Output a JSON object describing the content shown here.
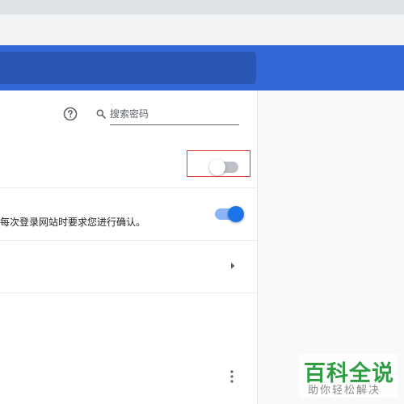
{
  "search": {
    "placeholder": "搜索密码",
    "value": ""
  },
  "settings": {
    "row_offer_save": {
      "toggle_state": "off",
      "highlight_color": "#e53935"
    },
    "row_auto_signin": {
      "description": "每次登录网站时要求您进行确认。",
      "toggle_state": "on"
    },
    "row_check_passwords": {
      "action": "expand"
    }
  },
  "icons": {
    "help": "help-circle-icon",
    "search": "search-icon",
    "arrow": "arrow-right-icon",
    "more": "more-vert-icon"
  },
  "colors": {
    "header_blue": "#3367d6",
    "toggle_on": "#1a73e8",
    "toggle_off": "#bdc1c6"
  },
  "watermark": {
    "logo_text": "百科全说",
    "subtitle": "助你轻松解决"
  }
}
